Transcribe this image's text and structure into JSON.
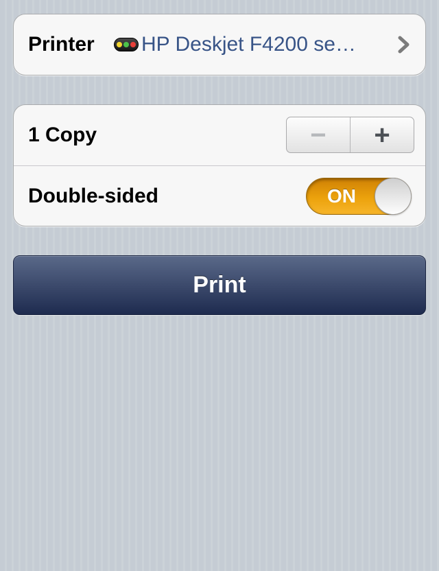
{
  "printer": {
    "label": "Printer",
    "value": "HP Deskjet F4200 se…",
    "status_colors": [
      "#f4d630",
      "#4cc24a",
      "#e8403a"
    ]
  },
  "copies": {
    "label": "1 Copy",
    "decrement_symbol": "−",
    "increment_symbol": "+"
  },
  "double_sided": {
    "label": "Double-sided",
    "state": "ON"
  },
  "print_button": {
    "label": "Print"
  },
  "colors": {
    "accent": "#eca20c",
    "printer_text": "#385487",
    "button": "#3c4a6c"
  }
}
